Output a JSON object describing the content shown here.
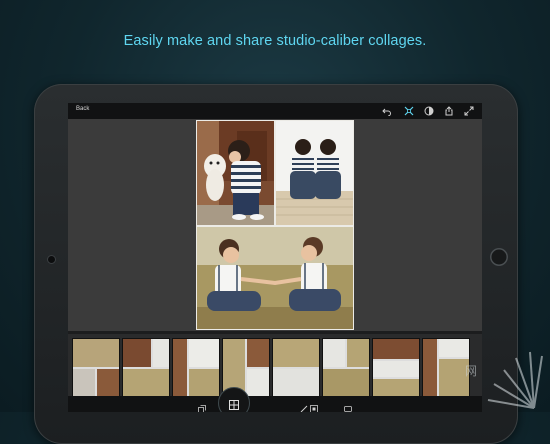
{
  "marketing": {
    "headline": "Easily make and share studio-caliber collages."
  },
  "app": {
    "topbar": {
      "back_label": "Back",
      "icons": [
        "undo-icon",
        "layout-grid-icon",
        "color-theme-icon",
        "share-icon",
        "fullscreen-icon"
      ]
    },
    "collage": {
      "tiles": [
        {
          "name": "photo-boy-with-dog"
        },
        {
          "name": "photo-two-boys-on-deck"
        },
        {
          "name": "photo-two-boys-in-field"
        }
      ]
    },
    "tray": {
      "thumbnails": [
        {
          "label": "layout-1"
        },
        {
          "label": "layout-2"
        },
        {
          "label": "layout-3"
        },
        {
          "label": "layout-4"
        },
        {
          "label": "layout-5"
        },
        {
          "label": "layout-6"
        },
        {
          "label": "layout-7"
        },
        {
          "label": "layout-8"
        }
      ]
    },
    "bottombar": {
      "icons": [
        "photos-icon",
        "layout-icon",
        "brush-icon",
        "border-icon",
        "frame-icon"
      ]
    }
  },
  "watermark": {
    "text": "网"
  },
  "colors": {
    "accent": "#5fd6f0",
    "screen_bg": "#3b3b3b",
    "bar_bg": "#111213"
  }
}
